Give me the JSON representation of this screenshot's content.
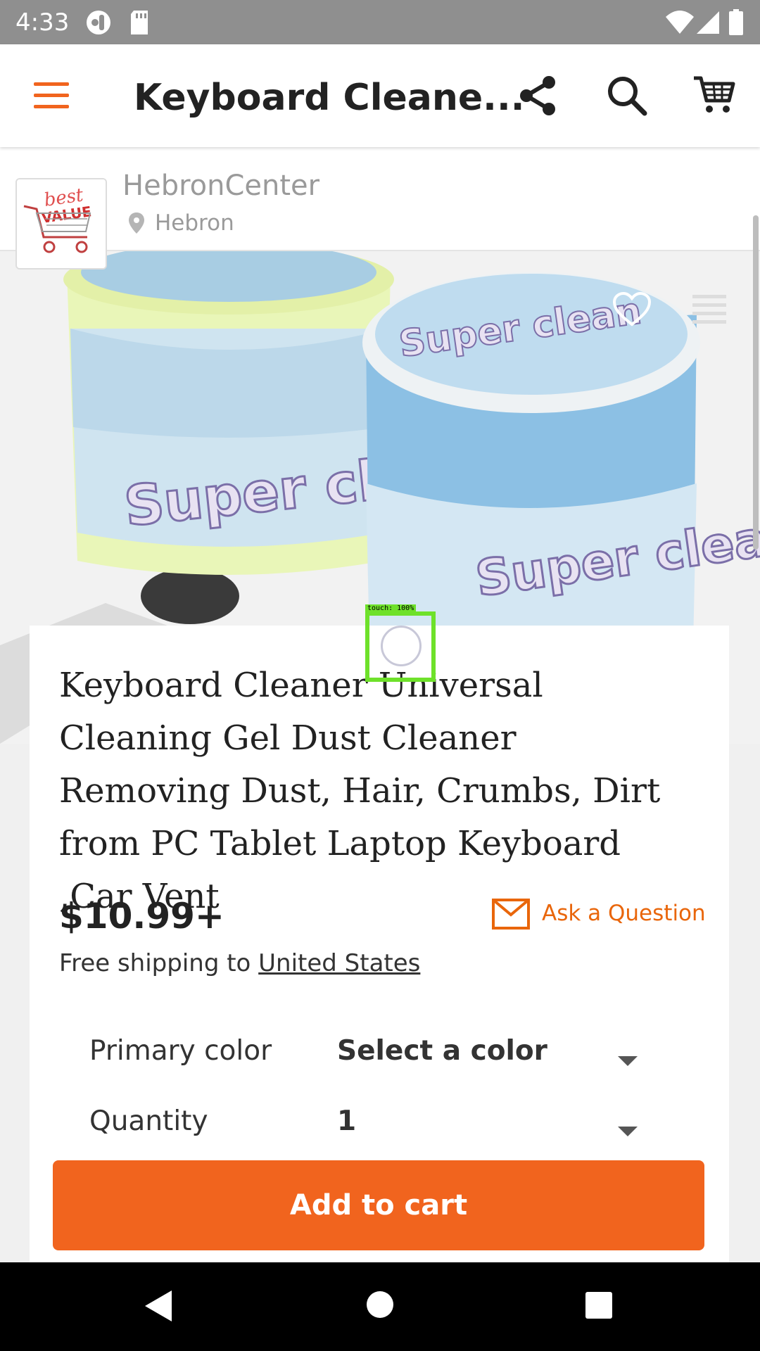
{
  "status_bar": {
    "time": "4:33",
    "icons": [
      "incognito-icon",
      "sd-card-icon",
      "wifi-icon",
      "signal-icon",
      "battery-icon"
    ]
  },
  "app_bar": {
    "title": "Keyboard Cleane...",
    "menu_icon": "hamburger-menu-icon",
    "share_icon": "share-icon",
    "search_icon": "search-icon",
    "cart_icon": "shopping-cart-icon",
    "accent_color": "#f1641e"
  },
  "shop": {
    "name": "HebronCenter",
    "location": "Hebron",
    "logo_text": "best VALUE",
    "location_icon": "map-pin-icon"
  },
  "hero_image": {
    "jar_texts": [
      "Super clean",
      "Super clean",
      "Super clean"
    ],
    "favorite_icon": "heart-icon",
    "list_icon": "list-icon"
  },
  "product": {
    "title": "Keyboard Cleaner Universal Cleaning Gel Dust Cleaner Removing Dust, Hair, Crumbs, Dirt from PC Tablet Laptop Keyboard ,Car Vent",
    "price": "$10.99+",
    "ask_label": "Ask a Question",
    "shipping_prefix": "Free shipping to ",
    "shipping_destination": "United States"
  },
  "options": {
    "primary_color_label": "Primary color",
    "primary_color_value": "Select a color",
    "quantity_label": "Quantity",
    "quantity_value": "1"
  },
  "cta": {
    "add_to_cart_label": "Add to cart"
  },
  "touch_indicator": {
    "label": "touch: 100%"
  },
  "nav_bar": {
    "icons": [
      "back-icon",
      "home-icon",
      "recents-icon"
    ]
  }
}
